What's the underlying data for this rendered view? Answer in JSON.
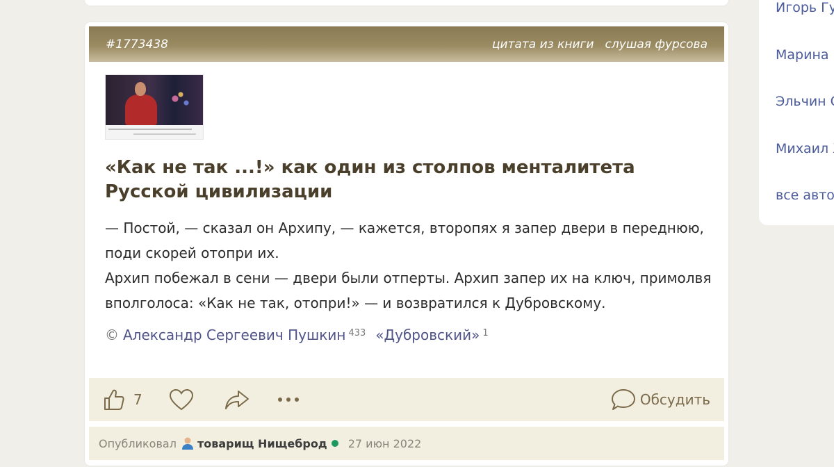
{
  "quote": {
    "id_label": "#1773438",
    "tags": [
      "цитата из книги",
      "слушая фурсова"
    ],
    "title": "«Как не так ...!» как один из столпов менталитета Русской цивилизации",
    "paragraphs": [
      "— Постой, — сказал он Архипу, — кажется, второпях я запер двери в переднюю, поди скорей отопри их.",
      "Архип побежал в сени — двери были отперты. Архип запер их на ключ, примолвя вполголоса: «Как не так, отопри!» — и возвратился к Дубровскому."
    ],
    "source": {
      "copyright": "©",
      "author": "Александр Сергеевич Пушкин",
      "author_count": "433",
      "book": "«Дубровский»",
      "book_count": "1"
    }
  },
  "actions": {
    "like_count": "7",
    "discuss_label": "Обсудить"
  },
  "footer": {
    "published_label": "Опубликовал",
    "author": "товарищ Нищеброд",
    "date": "27 июн 2022"
  },
  "sidebar": {
    "authors": [
      "Игорь Гу",
      "Марина",
      "Эльчин С",
      "Михаил Х"
    ],
    "all_authors": "все автор"
  },
  "colors": {
    "header": "#9b8b62",
    "accent_text": "#7a6a4a",
    "link": "#4f5388",
    "online": "#1f9a5e"
  }
}
